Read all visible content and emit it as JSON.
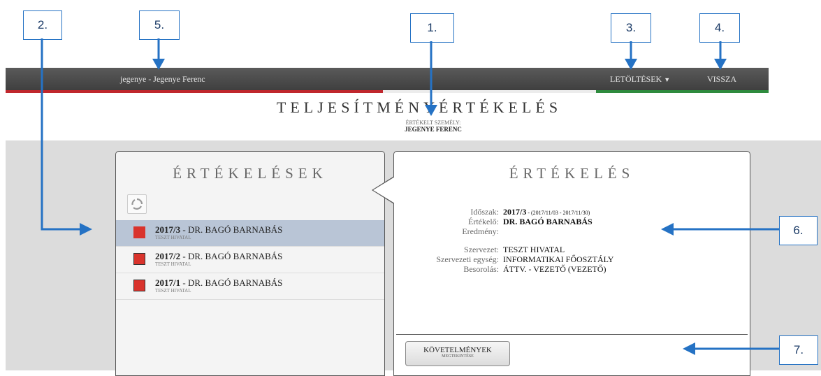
{
  "header": {
    "user": "jegenye - Jegenye Ferenc",
    "downloads": "LETÖLTÉSEK",
    "back": "VISSZA"
  },
  "page": {
    "title": "TELJESÍTMÉNYÉRTÉKELÉS",
    "person_label": "ÉRTÉKELT SZEMÉLY:",
    "person_name": "JEGENYE FERENC"
  },
  "left_panel": {
    "title": "ÉRTÉKELÉSEK",
    "items": [
      {
        "period": "2017/3",
        "evaluator": " - DR. BAGÓ BARNABÁS",
        "org": "TESZT HIVATAL",
        "selected": true
      },
      {
        "period": "2017/2",
        "evaluator": " - DR. BAGÓ BARNABÁS",
        "org": "TESZT HIVATAL",
        "selected": false
      },
      {
        "period": "2017/1",
        "evaluator": " - DR. BAGÓ BARNABÁS",
        "org": "TESZT HIVATAL",
        "selected": false
      }
    ]
  },
  "right_panel": {
    "title": "ÉRTÉKELÉS",
    "labels": {
      "period": "Időszak:",
      "evaluator": "Értékelő:",
      "result": "Eredmény:",
      "org": "Szervezet:",
      "unit": "Szervezeti egység:",
      "class": "Besorolás:"
    },
    "values": {
      "period": "2017/3",
      "period_range": " - (2017/11/03 - 2017/11/30)",
      "evaluator": "DR. BAGÓ BARNABÁS",
      "result": "",
      "org": "TESZT HIVATAL",
      "unit": "INFORMATIKAI FŐOSZTÁLY",
      "class": "ÁTTV. - VEZETŐ (VEZETŐ)"
    },
    "requirements_button": {
      "label": "KÖVETELMÉNYEK",
      "sublabel": "MEGTEKINTÉSE"
    }
  },
  "callouts": [
    "1.",
    "2.",
    "3.",
    "4.",
    "5.",
    "6.",
    "7."
  ],
  "colors": {
    "accent_blue": "#2572c4",
    "selected_row": "#b9c5d6",
    "status_red": "#d9332c",
    "stripe_green": "#2e8b3e"
  }
}
